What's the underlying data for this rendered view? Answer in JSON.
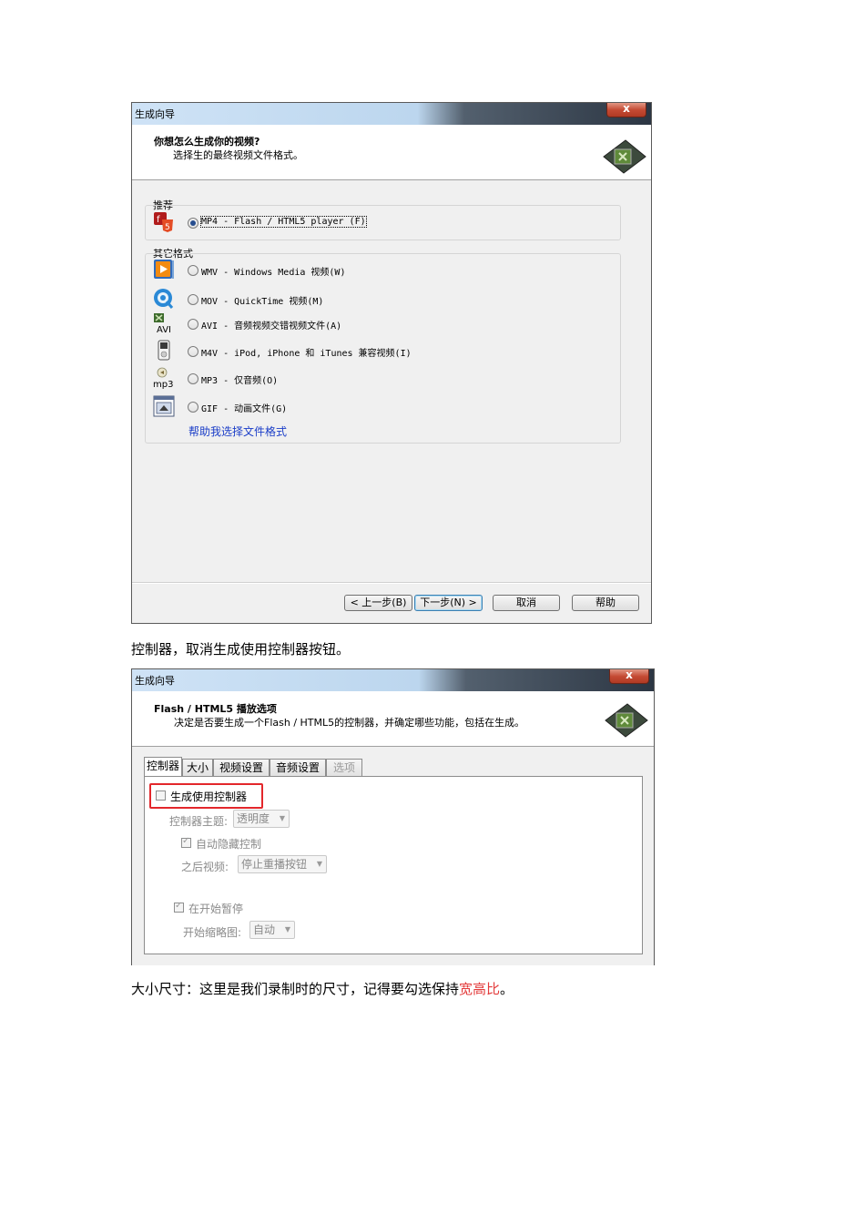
{
  "dialog1": {
    "title": "生成向导",
    "close": "x",
    "header_title": "你想怎么生成你的视频?",
    "header_subtitle": "选择生的最终视频文件格式。",
    "recommended_label": "推荐",
    "recommended_option": "MP4 - Flash / HTML5 player (F)",
    "other_label": "其它格式",
    "formats": [
      "WMV - Windows Media 视频(W)",
      "MOV - QuickTime 视频(M)",
      "AVI - 音频视频交错视频文件(A)",
      "M4V - iPod, iPhone 和 iTunes 兼容视频(I)",
      "MP3 - 仅音频(O)",
      "GIF - 动画文件(G)"
    ],
    "help_link": "帮助我选择文件格式",
    "buttons": {
      "back": "< 上一步(B)",
      "next": "下一步(N) >",
      "cancel": "取消",
      "help": "帮助"
    }
  },
  "para1": "控制器，取消生成使用控制器按钮。",
  "dialog2": {
    "title": "生成向导",
    "close": "x",
    "header_title": "Flash / HTML5 播放选项",
    "header_subtitle": "决定是否要生成一个Flash / HTML5的控制器，并确定哪些功能，包括在生成。",
    "tabs": [
      "控制器",
      "大小",
      "视频设置",
      "音频设置",
      "选项"
    ],
    "use_controller": "生成使用控制器",
    "theme_label": "控制器主题:",
    "theme_value": "透明度",
    "autohide": "自动隐藏控制",
    "after_label": "之后视频:",
    "after_value": "停止重播按钮",
    "pause_at_start": "在开始暂停",
    "thumb_label": "开始缩略图:",
    "thumb_value": "自动"
  },
  "para2": {
    "before": "大小尺寸：这里是我们录制时的尺寸，记得要勾选保持",
    "highlight": "宽高比",
    "after": "。"
  },
  "colors": {
    "highlight": "#e33b3b",
    "link": "#1a3dc8",
    "redbox": "#e3272b"
  }
}
